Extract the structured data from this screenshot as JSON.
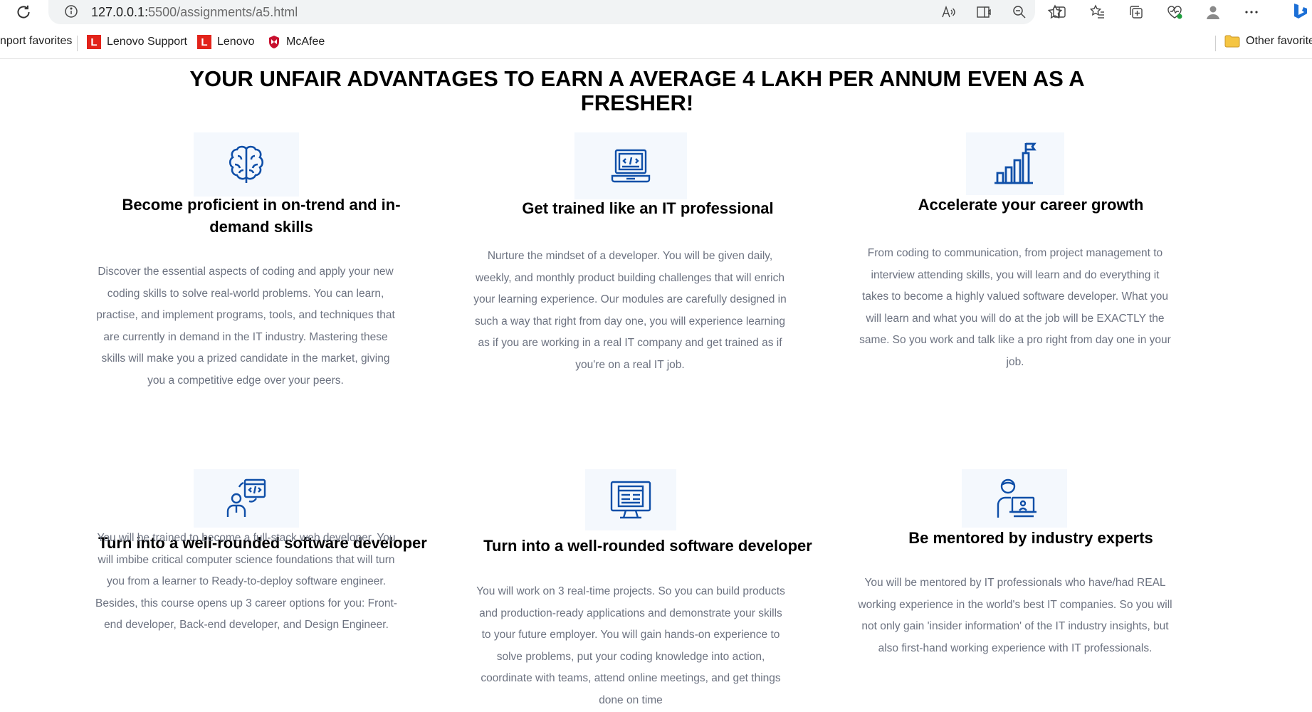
{
  "browser": {
    "url_host": "127.0.0.1:",
    "url_rest": "5500/assignments/a5.html",
    "favorites": [
      {
        "label": "nport favorites"
      },
      {
        "label": "Lenovo Support",
        "icon": "L"
      },
      {
        "label": "Lenovo",
        "icon": "L"
      },
      {
        "label": "McAfee"
      }
    ],
    "other_favorites": "Other favorite"
  },
  "page": {
    "title": "YOUR UNFAIR ADVANTAGES TO EARN A AVERAGE 4 LAKH PER ANNUM EVEN AS A FRESHER!",
    "accent_color": "#0f4fa8",
    "cards": [
      {
        "icon": "brain-icon",
        "heading": "Become proficient in on-trend and in-demand skills",
        "body": "Discover the essential aspects of coding and apply your new coding skills to solve real-world problems. You can learn, practise, and implement programs, tools, and techniques that are currently in demand in the IT industry. Mastering these skills will make you a prized candidate in the market, giving you a competitive edge over your peers."
      },
      {
        "icon": "laptop-code-icon",
        "heading": "Get trained like an IT professional",
        "body": "Nurture the mindset of a developer. You will be given daily, weekly, and monthly product building challenges that will enrich your learning experience. Our modules are carefully designed in such a way that right from day one, you will experience learning as if you are working in a real IT company and get trained as if you're on a real IT job."
      },
      {
        "icon": "growth-chart-flag-icon",
        "heading": "Accelerate your career growth",
        "body": "From coding to communication, from project management to interview attending skills, you will learn and do everything it takes to become a highly valued software developer. What you will learn and what you will do at the job will be EXACTLY the same. So you work and talk like a pro right from day one in your job."
      },
      {
        "icon": "developer-code-icon",
        "heading": "Turn into a well-rounded software developer",
        "body": "You will be trained to become a full-stack web developer. You will imbibe critical computer science foundations that will turn you from a learner to Ready-to-deploy software engineer. Besides, this course opens up 3 career options for you: Front-end developer, Back-end developer, and Design Engineer."
      },
      {
        "icon": "monitor-layout-icon",
        "heading": "Turn into a well-rounded software developer",
        "body": "You will work on 3 real-time projects. So you can build products and production-ready applications and demonstrate your skills to your future employer. You will gain hands-on experience to solve problems, put your coding knowledge into action, coordinate with teams, attend online meetings, and get things done on time"
      },
      {
        "icon": "mentor-icon",
        "heading": "Be mentored by industry experts",
        "body": "You will be mentored by IT professionals who have/had REAL working experience in the world's best IT companies. So you will not only gain 'insider information' of the IT industry insights, but also first-hand working experience with IT professionals."
      }
    ]
  }
}
